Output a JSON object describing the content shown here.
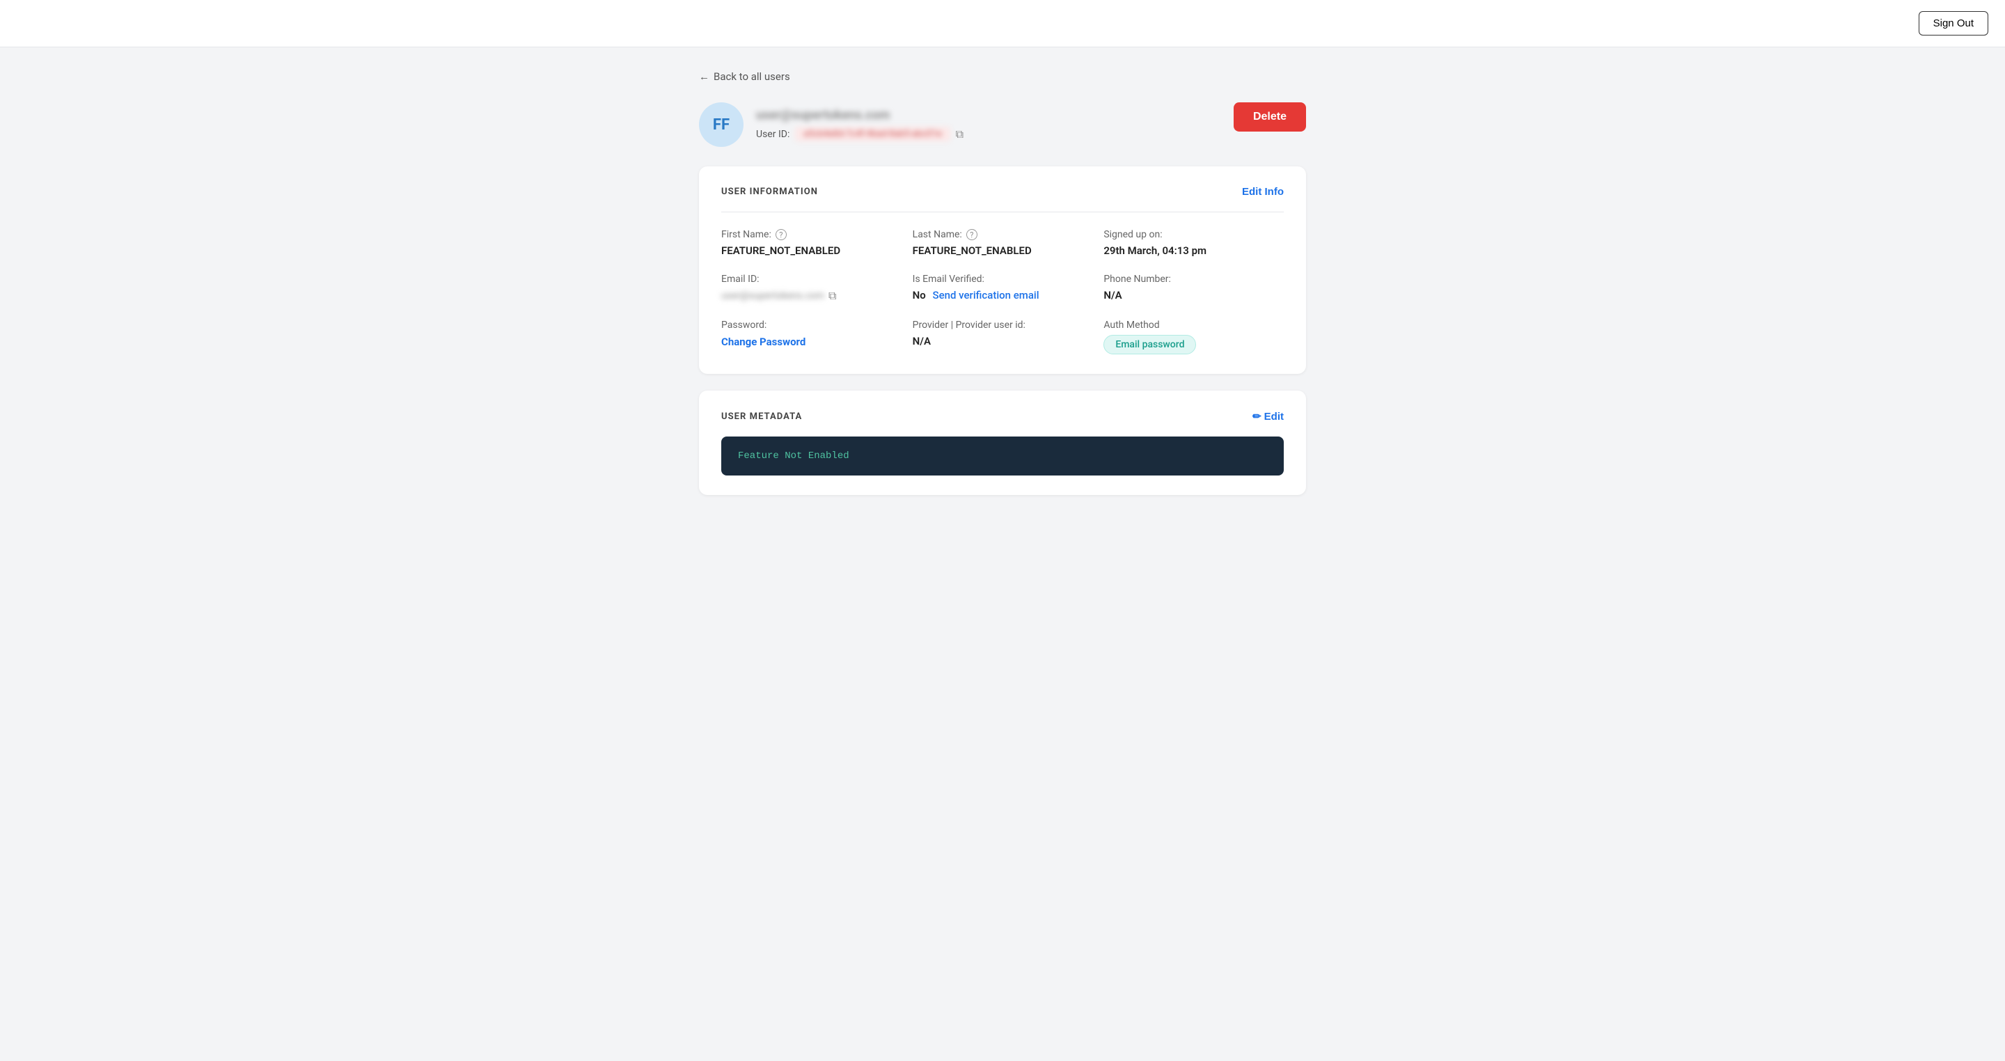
{
  "topbar": {
    "sign_out_label": "Sign Out"
  },
  "back_link": {
    "label": "Back to all users",
    "arrow": "←"
  },
  "user_header": {
    "avatar_initials": "FF",
    "email": "user@supertokens.com",
    "user_id_label": "User ID:",
    "user_id_value": "a5cb4e8d-7c4f-4bad-8ab5-abc01e",
    "delete_label": "Delete"
  },
  "user_information": {
    "section_title": "USER INFORMATION",
    "edit_info_label": "Edit Info",
    "first_name": {
      "label": "First Name:",
      "value": "FEATURE_NOT_ENABLED",
      "has_help": true
    },
    "last_name": {
      "label": "Last Name:",
      "value": "FEATURE_NOT_ENABLED",
      "has_help": true
    },
    "signed_up_on": {
      "label": "Signed up on:",
      "value": "29th March, 04:13 pm"
    },
    "email_id": {
      "label": "Email ID:",
      "value": "user@supertokens.com"
    },
    "is_email_verified": {
      "label": "Is Email Verified:",
      "no_label": "No",
      "send_verification_label": "Send verification email"
    },
    "phone_number": {
      "label": "Phone Number:",
      "value": "N/A"
    },
    "password": {
      "label": "Password:",
      "change_label": "Change Password"
    },
    "provider": {
      "label": "Provider | Provider user id:",
      "value": "N/A"
    },
    "auth_method": {
      "label": "Auth Method",
      "badge": "Email password"
    }
  },
  "user_metadata": {
    "section_title": "USER METADATA",
    "edit_label": "Edit",
    "edit_icon": "✏",
    "code_value": "Feature Not Enabled"
  },
  "icons": {
    "copy": "⧉",
    "help": "?",
    "pencil": "✏"
  }
}
